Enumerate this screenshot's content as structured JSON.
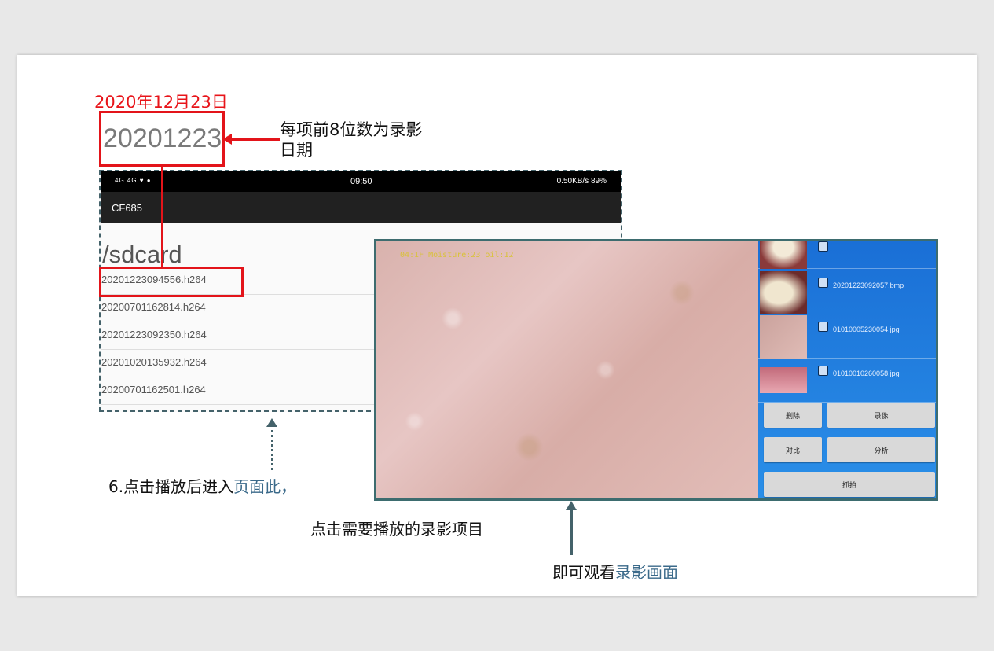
{
  "date_label": "2020年12月23日",
  "big_date": "20201223",
  "note_right": "每项前8位数为录影日期",
  "phone": {
    "status_left": "4G 4G ♥ ●",
    "status_time": "09:50",
    "status_right": "0.50KB/s  89%",
    "app_title": "CF685",
    "path": "/sdcard",
    "files": [
      "20201223094556.h264",
      "20200701162814.h264",
      "20201223092350.h264",
      "20201020135932.h264",
      "20200701162501.h264"
    ]
  },
  "camera": {
    "overlay": "04:1F  Moisture:23 oil:12",
    "gallery_files": [
      "",
      "20201223092057.bmp",
      "01010005230054.jpg",
      "01010010260058.jpg"
    ],
    "buttons": {
      "delete": "删除",
      "record": "录像",
      "compare": "对比",
      "analyze": "分析",
      "capture": "抓拍"
    }
  },
  "captions": {
    "cap1_main": "6.点击播放后进入",
    "cap1_hl": "页面此，",
    "cap2": "点击需要播放的录影项目",
    "cap3_main": "即可观看",
    "cap3_hl": "录影画面"
  }
}
